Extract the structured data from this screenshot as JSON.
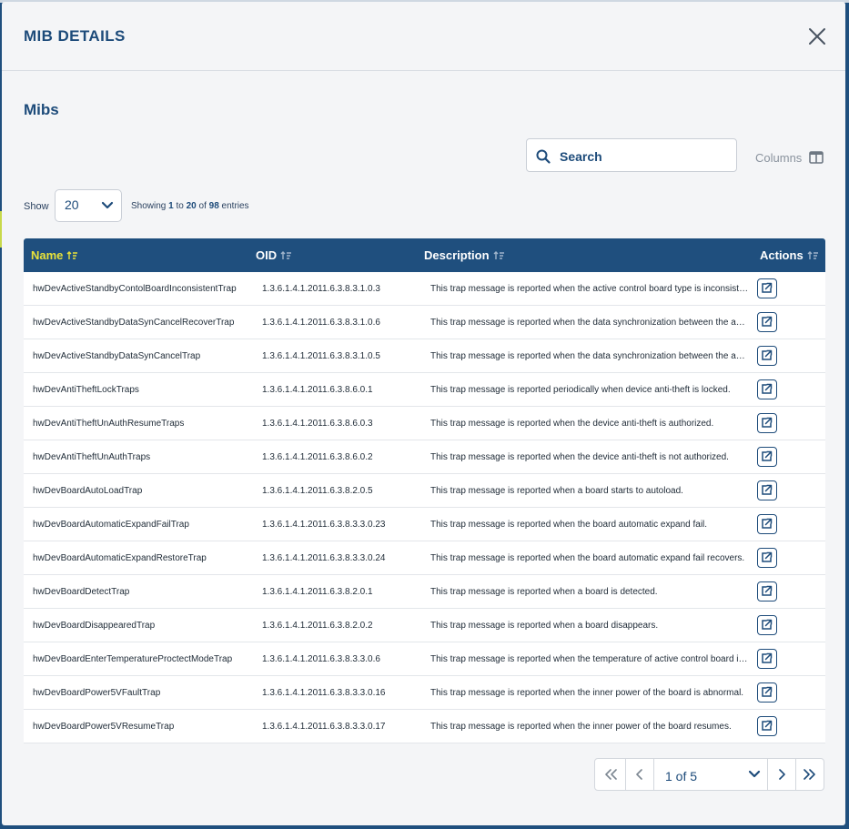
{
  "modal": {
    "title": "MIB DETAILS"
  },
  "section": {
    "title": "Mibs"
  },
  "search": {
    "placeholder": "Search"
  },
  "columns_label": "Columns",
  "show": {
    "label": "Show",
    "value": "20"
  },
  "entries": {
    "prefix": "Showing",
    "from": "1",
    "to_word": "to",
    "to": "20",
    "of_word": "of",
    "total": "98",
    "suffix": "entries"
  },
  "table": {
    "headers": [
      "Name",
      "OID",
      "Description",
      "Actions"
    ],
    "rows": [
      {
        "name": "hwDevActiveStandbyContolBoardInconsistentTrap",
        "oid": "1.3.6.1.4.1.2011.6.3.8.3.1.0.3",
        "desc": "This trap message is reported when the active control board type is inconsistent with the standby control board type."
      },
      {
        "name": "hwDevActiveStandbyDataSynCancelRecoverTrap",
        "oid": "1.3.6.1.4.1.2011.6.3.8.3.1.0.6",
        "desc": "This trap message is reported when the data synchronization between the active and standby control boards recovers."
      },
      {
        "name": "hwDevActiveStandbyDataSynCancelTrap",
        "oid": "1.3.6.1.4.1.2011.6.3.8.3.1.0.5",
        "desc": "This trap message is reported when the data synchronization between the active and standby control boards is cancelled."
      },
      {
        "name": "hwDevAntiTheftLockTraps",
        "oid": "1.3.6.1.4.1.2011.6.3.8.6.0.1",
        "desc": "This trap message is reported periodically when device anti-theft is locked."
      },
      {
        "name": "hwDevAntiTheftUnAuthResumeTraps",
        "oid": "1.3.6.1.4.1.2011.6.3.8.6.0.3",
        "desc": "This trap message is reported when the device anti-theft is authorized."
      },
      {
        "name": "hwDevAntiTheftUnAuthTraps",
        "oid": "1.3.6.1.4.1.2011.6.3.8.6.0.2",
        "desc": "This trap message is reported when the device anti-theft is not authorized."
      },
      {
        "name": "hwDevBoardAutoLoadTrap",
        "oid": "1.3.6.1.4.1.2011.6.3.8.2.0.5",
        "desc": "This trap message is reported when a board starts to autoload."
      },
      {
        "name": "hwDevBoardAutomaticExpandFailTrap",
        "oid": "1.3.6.1.4.1.2011.6.3.8.3.3.0.23",
        "desc": "This trap message is reported when the board automatic expand fail."
      },
      {
        "name": "hwDevBoardAutomaticExpandRestoreTrap",
        "oid": "1.3.6.1.4.1.2011.6.3.8.3.3.0.24",
        "desc": "This trap message is reported when the board automatic expand fail recovers."
      },
      {
        "name": "hwDevBoardDetectTrap",
        "oid": "1.3.6.1.4.1.2011.6.3.8.2.0.1",
        "desc": "This trap message is reported when a board is detected."
      },
      {
        "name": "hwDevBoardDisappearedTrap",
        "oid": "1.3.6.1.4.1.2011.6.3.8.2.0.2",
        "desc": "This trap message is reported when a board disappears."
      },
      {
        "name": "hwDevBoardEnterTemperatureProctectModeTrap",
        "oid": "1.3.6.1.4.1.2011.6.3.8.3.3.0.6",
        "desc": "This trap message is reported when the temperature of active control board is too high."
      },
      {
        "name": "hwDevBoardPower5VFaultTrap",
        "oid": "1.3.6.1.4.1.2011.6.3.8.3.3.0.16",
        "desc": "This trap message is reported when the inner power of the board is abnormal."
      },
      {
        "name": "hwDevBoardPower5VResumeTrap",
        "oid": "1.3.6.1.4.1.2011.6.3.8.3.3.0.17",
        "desc": "This trap message is reported when the inner power of the board resumes."
      }
    ]
  },
  "pagination": {
    "current": "1 of 5"
  },
  "icons": {
    "close": "close-icon",
    "search": "search-icon",
    "columns": "columns-icon",
    "sort": "sort-icon",
    "action": "external-link-icon",
    "first": "double-chevron-left-icon",
    "prev": "chevron-left-icon",
    "next": "chevron-right-icon",
    "last": "double-chevron-right-icon",
    "dropdown": "chevron-down-icon"
  },
  "colors": {
    "primary": "#1d4b7a",
    "header_bg": "#1f4f7e",
    "active_sort": "#e8e23a",
    "modal_bg": "#f4f5f7"
  }
}
